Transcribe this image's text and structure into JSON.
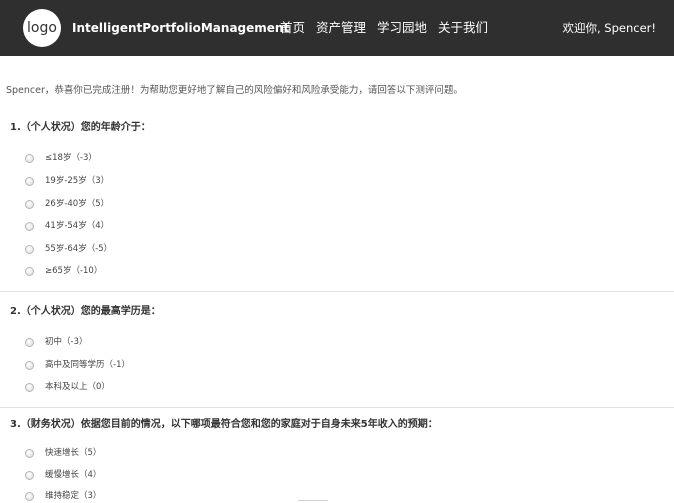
{
  "navbar": {
    "logo_text": "logo",
    "brand": "IntelligentPortfolioManagement",
    "links": [
      "首页",
      "资产管理",
      "学习园地",
      "关于我们"
    ],
    "welcome": "欢迎你, Spencer!"
  },
  "intro": "Spencer，恭喜你已完成注册！为帮助您更好地了解自己的风险偏好和风险承受能力，请回答以下测评问题。",
  "questions": [
    {
      "title": "1.（个人状况）您的年龄介于：",
      "options": [
        "≤18岁（-3）",
        "19岁-25岁（3）",
        "26岁-40岁（5）",
        "41岁-54岁（4）",
        "55岁-64岁（-5）",
        "≥65岁（-10）"
      ]
    },
    {
      "title": "2.（个人状况）您的最高学历是：",
      "options": [
        "初中（-3）",
        "高中及同等学历（-1）",
        "本科及以上（0）"
      ]
    },
    {
      "title": "3.（财务状况）依据您目前的情况，以下哪项最符合您和您的家庭对于自身未来5年收入的预期：",
      "options": [
        "快速增长（5）",
        "缓慢增长（4）",
        "维持稳定（3）"
      ]
    }
  ]
}
